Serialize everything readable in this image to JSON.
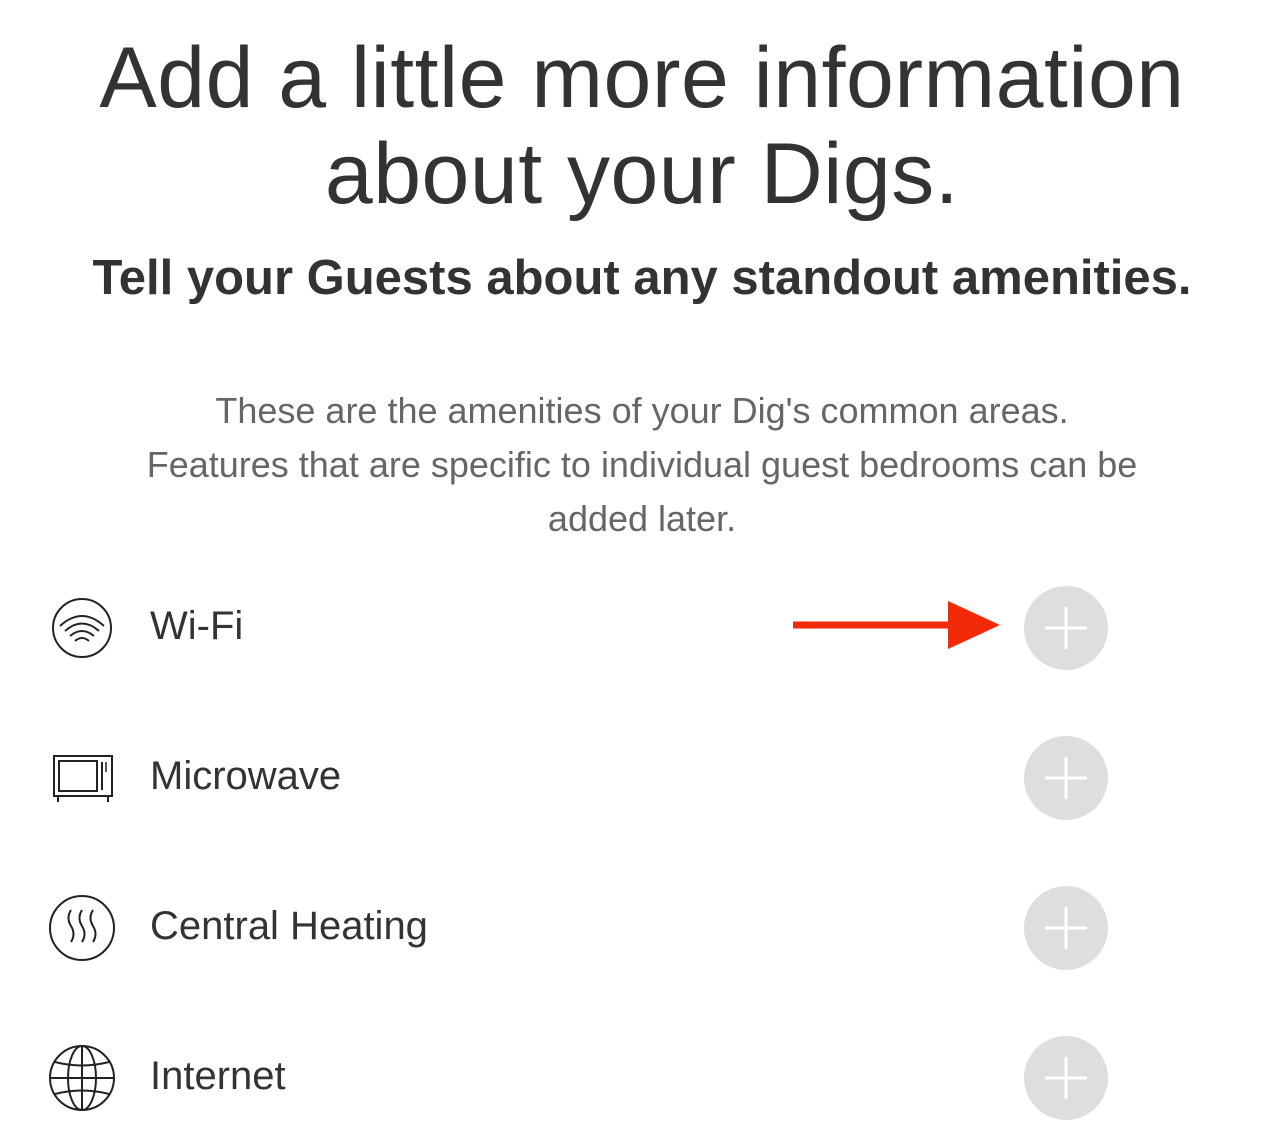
{
  "header": {
    "title_line1": "Add a little more information",
    "title_line2": "about your Digs.",
    "subtitle": "Tell your Guests about any standout amenities."
  },
  "description": {
    "line1": "These are the amenities of your Dig's common areas.",
    "line2": "Features that are specific to individual guest bedrooms can be",
    "line3": "added later."
  },
  "amenities": [
    {
      "label": "Wi-Fi",
      "icon": "wifi-icon"
    },
    {
      "label": "Microwave",
      "icon": "microwave-icon"
    },
    {
      "label": "Central Heating",
      "icon": "heating-icon"
    },
    {
      "label": "Internet",
      "icon": "globe-icon"
    }
  ],
  "annotation": {
    "arrow_color": "#f22a0a",
    "arrow_icon": "arrow-right-icon"
  },
  "colors": {
    "text_dark": "#333333",
    "text_muted": "#666666",
    "add_button_bg": "#dedede",
    "add_button_plus": "#ffffff"
  }
}
